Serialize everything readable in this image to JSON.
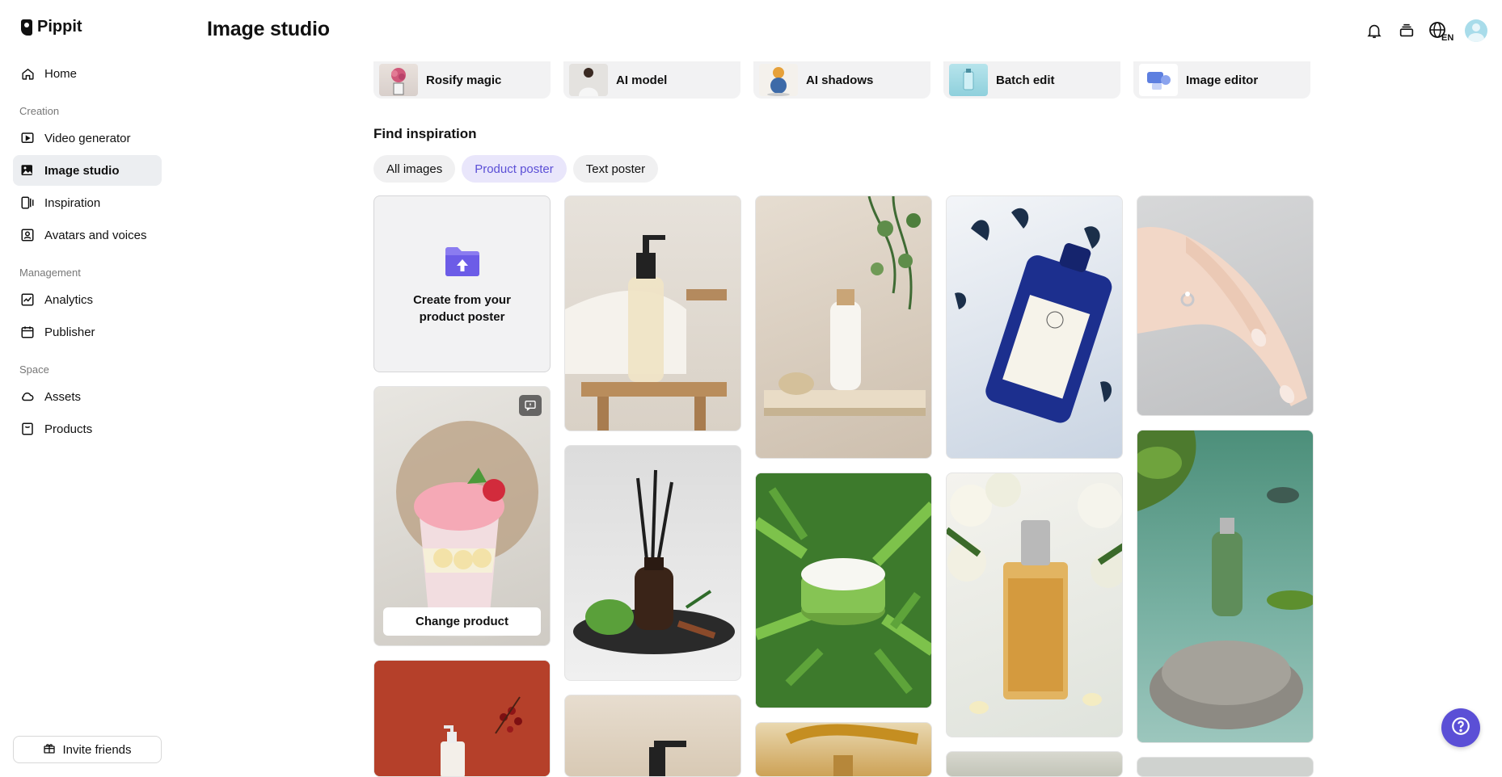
{
  "app": {
    "name": "Pippit"
  },
  "header": {
    "title": "Image studio",
    "language": "EN"
  },
  "sidebar": {
    "items": [
      {
        "label": "Home",
        "icon": "home-icon"
      },
      {
        "label": "Video generator",
        "icon": "video-generator-icon"
      },
      {
        "label": "Image studio",
        "icon": "image-studio-icon",
        "active": true
      },
      {
        "label": "Inspiration",
        "icon": "inspiration-icon"
      },
      {
        "label": "Avatars and voices",
        "icon": "avatar-voice-icon"
      },
      {
        "label": "Analytics",
        "icon": "analytics-icon"
      },
      {
        "label": "Publisher",
        "icon": "calendar-icon"
      },
      {
        "label": "Assets",
        "icon": "cloud-icon"
      },
      {
        "label": "Products",
        "icon": "products-icon"
      }
    ],
    "sections": {
      "creation": "Creation",
      "management": "Management",
      "space": "Space"
    },
    "invite_label": "Invite friends"
  },
  "tools": [
    {
      "label": "Rosify magic"
    },
    {
      "label": "AI model"
    },
    {
      "label": "AI shadows"
    },
    {
      "label": "Batch edit"
    },
    {
      "label": "Image editor"
    }
  ],
  "inspiration": {
    "title": "Find inspiration",
    "filters": [
      {
        "label": "All images",
        "selected": false
      },
      {
        "label": "Product poster",
        "selected": true
      },
      {
        "label": "Text poster",
        "selected": false
      }
    ],
    "create_card_text": "Create from your product poster",
    "change_product_label": "Change product"
  },
  "colors": {
    "accent": "#5b4fd6",
    "chip_selected_bg": "#e9e6fb",
    "active_nav_bg": "#eceef1"
  }
}
